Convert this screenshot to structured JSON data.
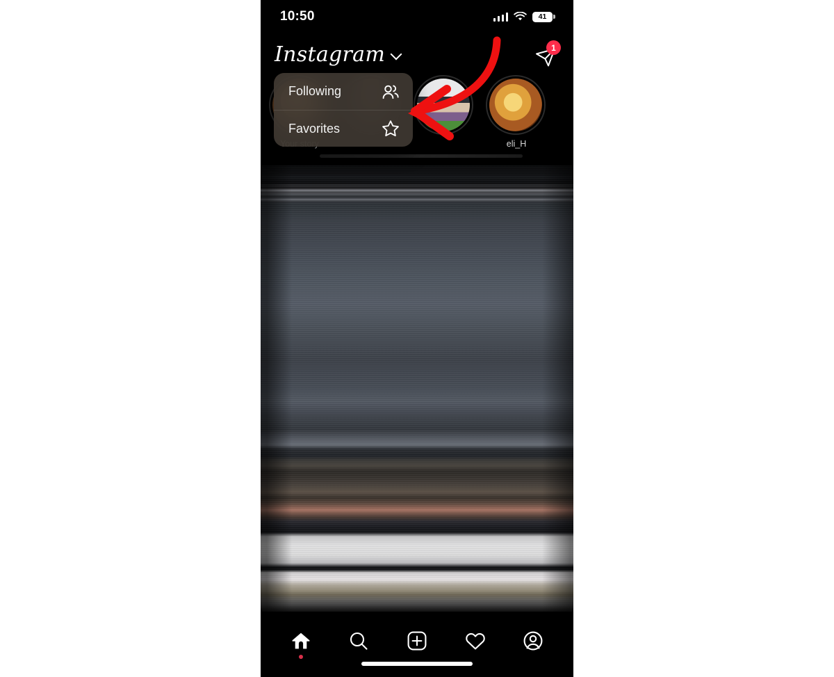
{
  "status_bar": {
    "time": "10:50",
    "battery_level": "41",
    "icons": [
      "cellular-signal-icon",
      "wifi-icon",
      "battery-icon"
    ]
  },
  "header": {
    "app_title": "Instagram",
    "dropdown_icon": "chevron-down-icon",
    "direct_icon": "send-icon",
    "direct_badge_count": "1"
  },
  "feed_switcher_menu": {
    "items": [
      {
        "label": "Following",
        "icon": "people-icon"
      },
      {
        "label": "Favorites",
        "icon": "star-icon"
      }
    ]
  },
  "stories": {
    "items": [
      {
        "name": "Your story",
        "avatar": "av-you"
      },
      {
        "name": "",
        "avatar": "av-man"
      },
      {
        "name": "",
        "avatar": "av-car"
      },
      {
        "name": "eli_H",
        "avatar": "av-food"
      }
    ]
  },
  "annotation": {
    "type": "hand-drawn-arrow",
    "color": "#ee1111",
    "direction": "points-left-toward-menu"
  },
  "feed_post": {
    "state": "motion-blurred-photo"
  },
  "tab_bar": {
    "items": [
      {
        "name": "home-tab",
        "icon": "home-icon",
        "active": true,
        "has_dot": true
      },
      {
        "name": "search-tab",
        "icon": "search-icon",
        "active": false,
        "has_dot": false
      },
      {
        "name": "create-tab",
        "icon": "plus-square-icon",
        "active": false,
        "has_dot": false
      },
      {
        "name": "activity-tab",
        "icon": "heart-icon",
        "active": false,
        "has_dot": false
      },
      {
        "name": "profile-tab",
        "icon": "profile-icon",
        "active": false,
        "has_dot": false
      }
    ]
  },
  "colors": {
    "background": "#000000",
    "accent_red": "#ff2d4b",
    "page_background": "#ffffff",
    "menu_background": "#3e3832"
  }
}
